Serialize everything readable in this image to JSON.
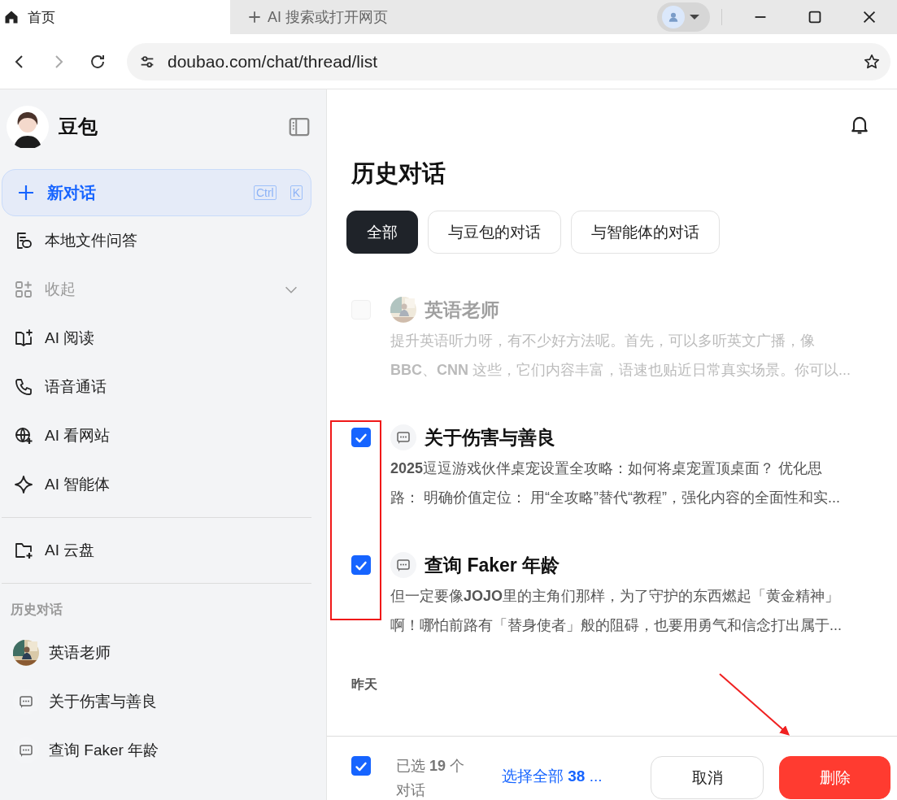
{
  "browser": {
    "tabs": [
      {
        "label": "首页",
        "selected": true
      }
    ],
    "new_tab": {
      "label": "AI 搜索或打开网页"
    },
    "url": "doubao.com/chat/thread/list"
  },
  "sidebar": {
    "brand": "豆包",
    "new_chat": {
      "label": "新对话",
      "shortcut": [
        "Ctrl",
        "K"
      ]
    },
    "nav_groups": [
      [
        {
          "label": "本地文件问答",
          "kind": "file"
        },
        {
          "label": "收起",
          "kind": "collapse"
        },
        {
          "label": "AI 阅读",
          "kind": "read"
        },
        {
          "label": "语音通话",
          "kind": "phone"
        },
        {
          "label": "AI 看网站",
          "kind": "globe"
        },
        {
          "label": "AI 智能体",
          "kind": "spark"
        }
      ],
      [
        {
          "label": "AI 云盘",
          "kind": "folder"
        }
      ]
    ],
    "history_label": "历史对话",
    "history": [
      {
        "title": "英语老师",
        "kind": "agent"
      },
      {
        "title": "关于伤害与善良",
        "kind": "chat"
      },
      {
        "title": "查询 Faker 年龄",
        "kind": "chat"
      }
    ]
  },
  "main": {
    "title": "历史对话",
    "filters": [
      {
        "label": "全部",
        "selected": true
      },
      {
        "label": "与豆包的对话",
        "selected": false
      },
      {
        "label": "与智能体的对话",
        "selected": false
      }
    ],
    "items": [
      {
        "title": "英语老师",
        "kind": "agent",
        "checked": false,
        "disabled": true,
        "preview_lines": [
          "提升英语听力呀，有不少好方法呢。首先，可以多听英文广播，像",
          "**BBC**、**CNN** 这些，它们内容丰富，语速也贴近日常真实场景。你可以..."
        ]
      },
      {
        "title": "关于伤害与善良",
        "kind": "chat",
        "checked": true,
        "disabled": false,
        "preview_lines": [
          "**2025**逗逗游戏伙伴桌宠设置全攻略：如何将桌宠置顶桌面？ 优化思",
          "路： 明确价值定位： 用“全攻略”替代“教程”，强化内容的全面性和实..."
        ]
      },
      {
        "title": "查询 Faker 年龄",
        "kind": "chat",
        "checked": true,
        "disabled": false,
        "preview_lines": [
          "但一定要像**JOJO**里的主角们那样，为了守护的东西燃起「黄金精神」",
          "啊！哪怕前路有「替身使者」般的阻碍，也要用勇气和信念打出属于..."
        ]
      }
    ],
    "section_label": "昨天",
    "footer": {
      "checked": true,
      "selected_text_lines": [
        "已选 **19** 个",
        "对话"
      ],
      "select_all": "选择全部 **38** ...",
      "cancel": "取消",
      "delete": "删除"
    }
  }
}
